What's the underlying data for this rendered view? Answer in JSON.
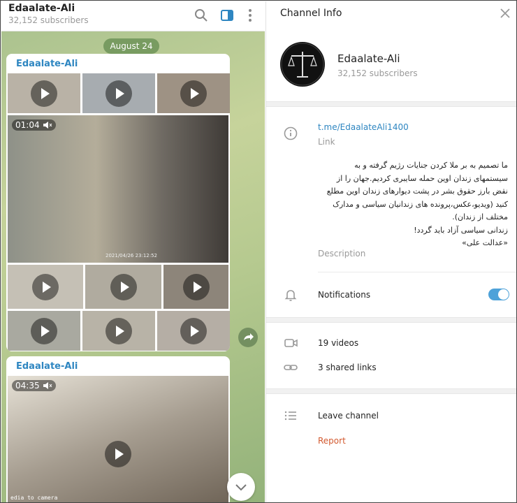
{
  "chat": {
    "title": "Edaalate-Ali",
    "subscribers": "32,152 subscribers",
    "date_pill": "August 24",
    "messages": [
      {
        "author": "Edaalate-Ali",
        "featured_duration": "01:04",
        "featured_timestamp": "2021/04/26 23:12:52"
      },
      {
        "author": "Edaalate-Ali",
        "featured_duration": "04:35",
        "cam_label": "edia to camera"
      }
    ]
  },
  "info": {
    "header_title": "Channel Info",
    "channel_name": "Edaalate-Ali",
    "subscribers": "32,152 subscribers",
    "link": "t.me/EdaalateAli1400",
    "link_label": "Link",
    "description_lines": [
      "ما تصمیم به بر ملا کردن جنایات رژیم گرفته و به",
      "سیستمهای زندان اوین حمله سایبری کردیم.جهان را از",
      "نقض بارز حقوق بشر در پشت دیوارهای زندان اوین مطلع",
      "کنید (ویدیو،عکس،پرونده های زندانیان سیاسی و مدارک",
      "مختلف از زندان).",
      "زندانی سیاسی آزاد باید گردد!",
      "«عدالت علی»"
    ],
    "description_label": "Description",
    "notifications_label": "Notifications",
    "notifications_on": true,
    "videos_label": "19 videos",
    "shared_links_label": "3 shared links",
    "leave_label": "Leave channel",
    "report_label": "Report"
  },
  "colors": {
    "accent": "#2e86c1",
    "toggle": "#4ea2d9",
    "danger": "#d2592f"
  }
}
